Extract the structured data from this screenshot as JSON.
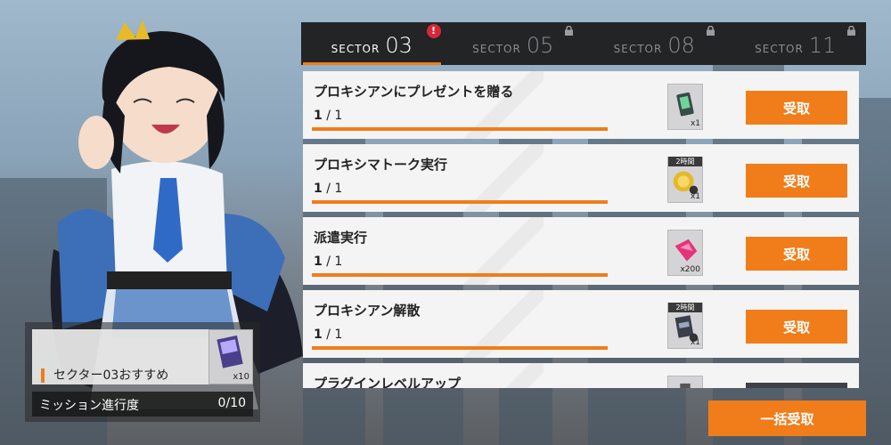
{
  "tabs": [
    {
      "label": "SECTOR",
      "num": "03",
      "state": "active",
      "alert": "!"
    },
    {
      "label": "SECTOR",
      "num": "05",
      "state": "locked"
    },
    {
      "label": "SECTOR",
      "num": "08",
      "state": "locked"
    },
    {
      "label": "SECTOR",
      "num": "11",
      "state": "locked"
    }
  ],
  "missions": [
    {
      "title": "プロキシアンにプレゼントを贈る",
      "current": "1",
      "total": "1",
      "progress": 1.0,
      "reward": {
        "icon": "gift-device-icon",
        "qty": "x1",
        "tag": ""
      },
      "claim_label": "受取"
    },
    {
      "title": "プロキシマトーク実行",
      "current": "1",
      "total": "1",
      "progress": 1.0,
      "reward": {
        "icon": "gold-coin-icon",
        "qty": "x1",
        "tag": "2時間"
      },
      "claim_label": "受取"
    },
    {
      "title": "派遣実行",
      "current": "1",
      "total": "1",
      "progress": 1.0,
      "reward": {
        "icon": "pink-crystal-icon",
        "qty": "x200",
        "tag": ""
      },
      "claim_label": "受取"
    },
    {
      "title": "プロキシアン解散",
      "current": "1",
      "total": "1",
      "progress": 1.0,
      "reward": {
        "icon": "exp-chip-icon",
        "qty": "x1",
        "tag": "2時間"
      },
      "claim_label": "受取"
    },
    {
      "title": "プラグインレベルアップ",
      "current": "",
      "total": "",
      "progress": 0,
      "reward": {
        "icon": "plugin-icon",
        "qty": "",
        "tag": ""
      },
      "claim_label": ""
    }
  ],
  "recommend": {
    "title": "セクター03おすすめ",
    "item_qty": "x10",
    "progress_label": "ミッション進行度",
    "progress_value": "0/10"
  },
  "claim_all_label": "一括受取",
  "colors": {
    "accent": "#f07d1a",
    "tab_bar": "#222426",
    "row_bg": "#f4f4f4",
    "alert": "#d7283a"
  }
}
